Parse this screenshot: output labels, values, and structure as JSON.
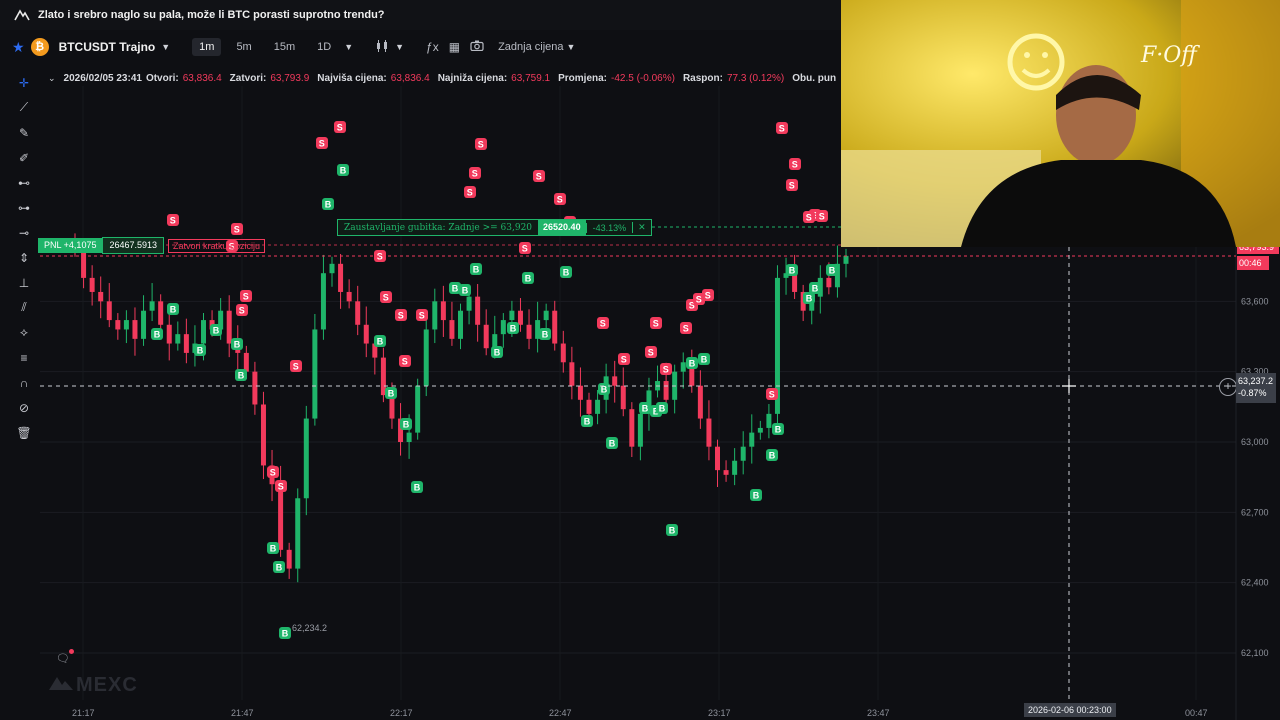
{
  "titlebar": {
    "logo_icon": "mexc-logo-icon",
    "title": "Zlato i srebro naglo su pala, može li BTC porasti suprotno trendu?"
  },
  "toolbar": {
    "symbol": "BTCUSDT Trajno",
    "coin_glyph": "₿",
    "intervals": [
      "1m",
      "5m",
      "15m",
      "1D"
    ],
    "active_interval": "1m",
    "last_price_label": "Zadnja cijena"
  },
  "ohlc": {
    "date": "2026/02/05 23:41",
    "open_label": "Otvori:",
    "open": "63,836.4",
    "close_label": "Zatvori:",
    "close": "63,793.9",
    "high_label": "Najviša cijena:",
    "high": "63,836.4",
    "low_label": "Najniža cijena:",
    "low": "63,759.1",
    "change_label": "Promjena:",
    "change": "-42.5 (-0.06%)",
    "range_label": "Raspon:",
    "range": "77.3 (0.12%)",
    "volume_label": "Obu. pun"
  },
  "position": {
    "pnl": "PNL +4,1075",
    "size": "26467.5913",
    "close_label": "Zatvori kratku poziciju"
  },
  "stop_loss": {
    "label": "Zaustavljanje gubitka: Zadnje >= 63,920",
    "value": "26520.40",
    "percent": "-43.13%",
    "close": "✕"
  },
  "y_axis": {
    "ticks": [
      "63,600",
      "63,300",
      "63,000",
      "62,700",
      "62,400",
      "62,100"
    ]
  },
  "x_axis": {
    "ticks": [
      "21:17",
      "21:47",
      "22:17",
      "22:47",
      "23:17",
      "23:47",
      "00:47"
    ]
  },
  "low_marker": "62,234.2",
  "crosshair": {
    "price": "63,237.2",
    "change": "-0.87%",
    "time": "2026-02-06 00:23:00"
  },
  "price_tags": {
    "current": "63,793.9",
    "countdown": "00:46"
  },
  "watermark": "MEXC",
  "colors": {
    "up": "#1fb56a",
    "down": "#f23a5c",
    "bg": "#0e0f13",
    "accent": "#2d6cf3"
  },
  "chart_data": {
    "type": "candlestick",
    "ylim": [
      61950,
      63950
    ],
    "signals_note": "B = buy marker, S = sell marker",
    "close_series": [
      63820,
      63700,
      63640,
      63600,
      63520,
      63480,
      63520,
      63440,
      63560,
      63600,
      63500,
      63420,
      63460,
      63380,
      63420,
      63520,
      63480,
      63560,
      63420,
      63380,
      63300,
      63160,
      62900,
      62820,
      62540,
      62460,
      62760,
      63100,
      63480,
      63720,
      63760,
      63640,
      63600,
      63500,
      63420,
      63360,
      63200,
      63100,
      63000,
      63040,
      63240,
      63480,
      63600,
      63520,
      63440,
      63560,
      63620,
      63500,
      63400,
      63460,
      63520,
      63560,
      63500,
      63440,
      63520,
      63560,
      63420,
      63340,
      63240,
      63180,
      63120,
      63180,
      63280,
      63240,
      63140,
      62980,
      63120,
      63220,
      63260,
      63180,
      63300,
      63340,
      63240,
      63100,
      62980,
      62880,
      62860,
      62920,
      62980,
      63040,
      63060,
      63120,
      63700,
      63720,
      63640,
      63560,
      63620,
      63700,
      63660,
      63760,
      63793.9
    ]
  },
  "webcam": {
    "description_icon": "webcam-overlay"
  }
}
